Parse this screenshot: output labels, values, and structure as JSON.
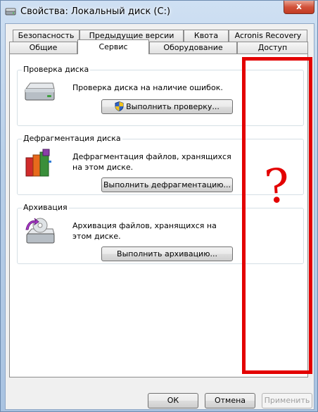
{
  "window": {
    "title": "Свойства: Локальный диск (C:)",
    "close_glyph": "x"
  },
  "tabs": {
    "row1": [
      "Безопасность",
      "Предыдущие версии",
      "Квота",
      "Acronis Recovery"
    ],
    "row2": [
      "Общие",
      "Сервис",
      "Оборудование",
      "Доступ"
    ],
    "active": "Сервис"
  },
  "groups": {
    "check": {
      "label": "Проверка диска",
      "description": "Проверка диска на наличие ошибок.",
      "button": "Выполнить проверку..."
    },
    "defrag": {
      "label": "Дефрагментация диска",
      "description": "Дефрагментация файлов, хранящихся на этом диске.",
      "button": "Выполнить дефрагментацию..."
    },
    "backup": {
      "label": "Архивация",
      "description": "Архивация файлов, хранящихся на этом диске.",
      "button": "Выполнить архивацию..."
    }
  },
  "annotation": {
    "text": "?",
    "color": "#e30000"
  },
  "footer": {
    "ok": "ОК",
    "cancel": "Отмена",
    "apply": "Применить"
  }
}
